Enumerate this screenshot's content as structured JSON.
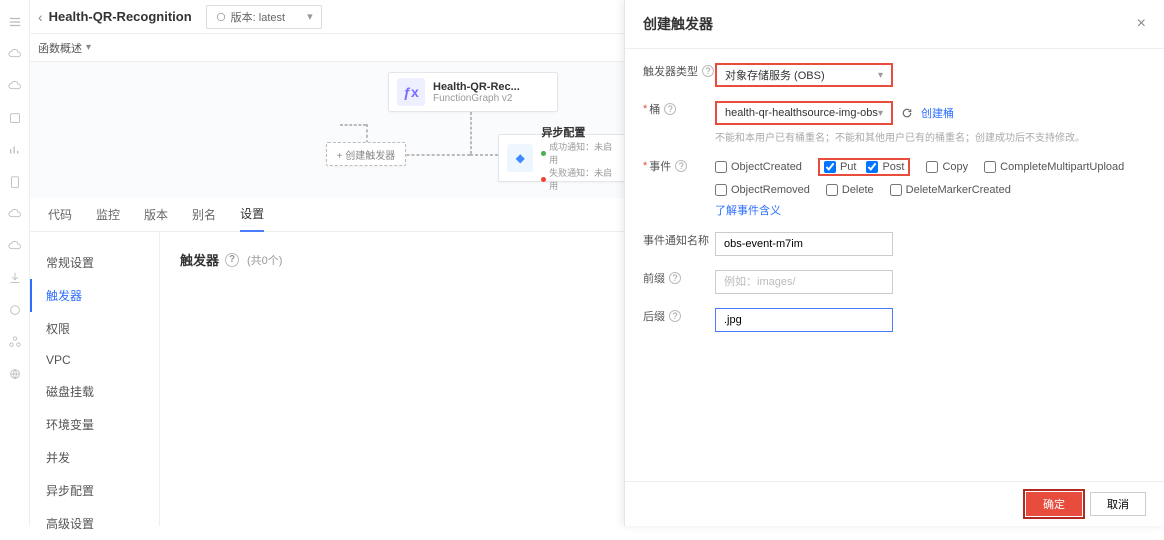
{
  "header": {
    "breadcrumb": "Health-QR-Recognition",
    "version_label": "版本: latest"
  },
  "secrow": {
    "label": "函数概述"
  },
  "canvas": {
    "fn_node": {
      "title": "Health-QR-Rec...",
      "subtitle": "FunctionGraph v2"
    },
    "add_node": "+ 创建触发器",
    "async_node": {
      "title": "异步配置",
      "line1": "成功通知：未启用",
      "line2": "失败通知：未启用"
    }
  },
  "tabs": [
    "代码",
    "监控",
    "版本",
    "别名",
    "设置"
  ],
  "active_tab": "设置",
  "settings_nav": [
    "常规设置",
    "触发器",
    "权限",
    "VPC",
    "磁盘挂载",
    "环境变量",
    "并发",
    "异步配置",
    "高级设置"
  ],
  "settings_active": "触发器",
  "settings_main": {
    "title": "触发器",
    "count": "(共0个)"
  },
  "drawer": {
    "title": "创建触发器",
    "fields": {
      "trigger_type": {
        "label": "触发器类型",
        "value": "对象存储服务 (OBS)"
      },
      "bucket": {
        "label": "桶",
        "value": "health-qr-healthsource-img-obs",
        "create": "创建桶",
        "hint": "不能和本用户已有桶重名；不能和其他用户已有的桶重名；创建成功后不支持修改。"
      },
      "events": {
        "label": "事件",
        "items": [
          {
            "name": "ObjectCreated",
            "checked": false
          },
          {
            "name": "Put",
            "checked": true
          },
          {
            "name": "Post",
            "checked": true
          },
          {
            "name": "Copy",
            "checked": false
          },
          {
            "name": "CompleteMultipartUpload",
            "checked": false
          },
          {
            "name": "ObjectRemoved",
            "checked": false
          },
          {
            "name": "Delete",
            "checked": false
          },
          {
            "name": "DeleteMarkerCreated",
            "checked": false
          }
        ],
        "link": "了解事件含义"
      },
      "event_name": {
        "label": "事件通知名称",
        "value": "obs-event-m7im"
      },
      "prefix": {
        "label": "前缀",
        "placeholder": "例如：images/"
      },
      "suffix": {
        "label": "后缀",
        "value": ".jpg"
      }
    },
    "footer": {
      "ok": "确定",
      "cancel": "取消"
    }
  }
}
